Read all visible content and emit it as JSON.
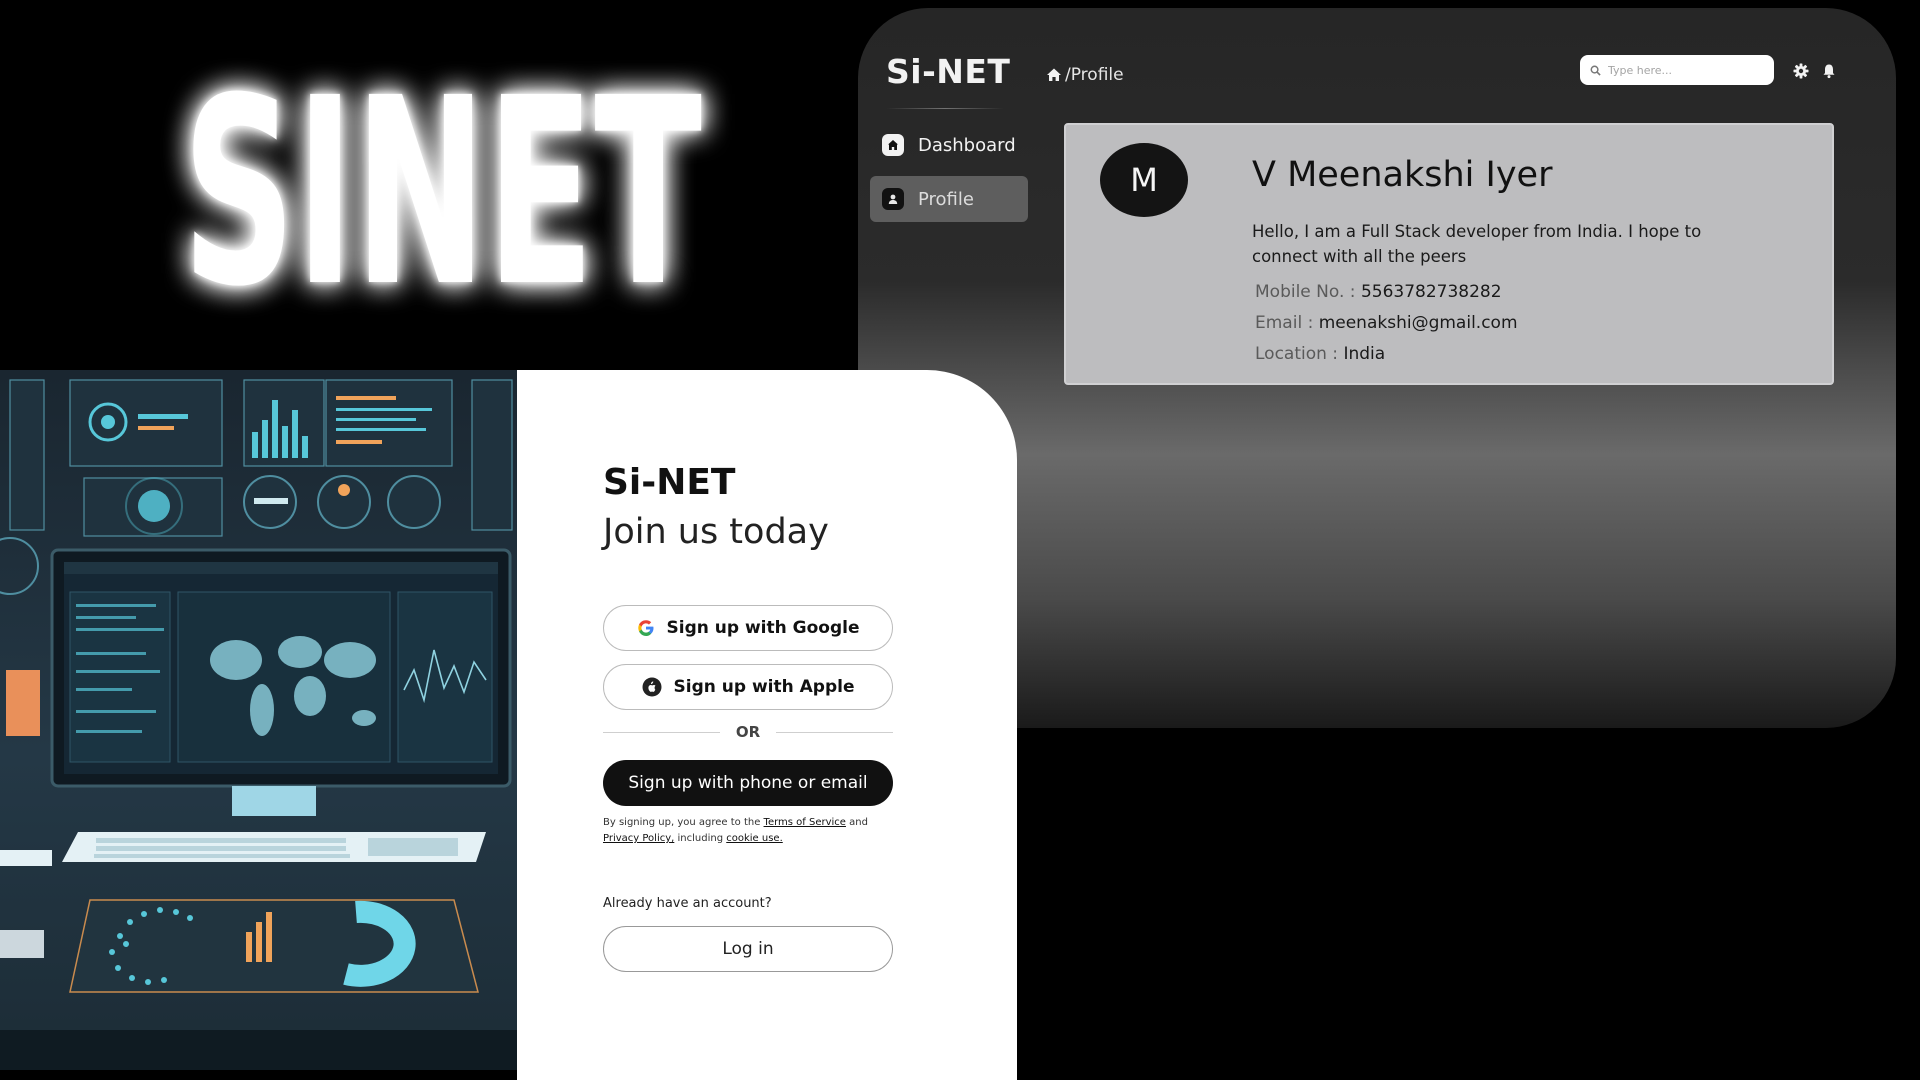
{
  "hero": {
    "logo_text": "SINET"
  },
  "dashboard": {
    "brand": "Si-NET",
    "breadcrumb": "/Profile",
    "search": {
      "placeholder": "Type here..."
    },
    "sidebar": {
      "items": [
        {
          "label": "Dashboard",
          "active": false
        },
        {
          "label": "Profile",
          "active": true
        }
      ]
    },
    "profile": {
      "avatar_initial": "M",
      "name": "V Meenakshi Iyer",
      "bio": "Hello, I am a Full Stack developer from India. I hope to connect with all the peers",
      "mobile_label": "Mobile No. :",
      "mobile": "5563782738282",
      "email_label": "Email :",
      "email": "meenakshi@gmail.com",
      "location_label": "Location :",
      "location": "India"
    }
  },
  "signup": {
    "brand": "Si-NET",
    "title": "Join us today",
    "google_label": "Sign up with Google",
    "apple_label": "Sign up with Apple",
    "or_label": "OR",
    "phone_email_label": "Sign up with phone or email",
    "terms_prefix": "By signing up, you agree to the",
    "terms_link": "Terms of Service",
    "terms_and": "and",
    "privacy_link": "Privacy Policy,",
    "terms_including": "including",
    "cookie_link": "cookie use.",
    "have_account": "Already have an account?",
    "login_label": "Log in"
  },
  "colors": {
    "background": "#000000",
    "panel_white": "#ffffff",
    "card_gray": "#bdbdbf",
    "dark_button": "#111111",
    "illustration_accent": "#57c7d9",
    "illustration_orange": "#f0a35a"
  }
}
